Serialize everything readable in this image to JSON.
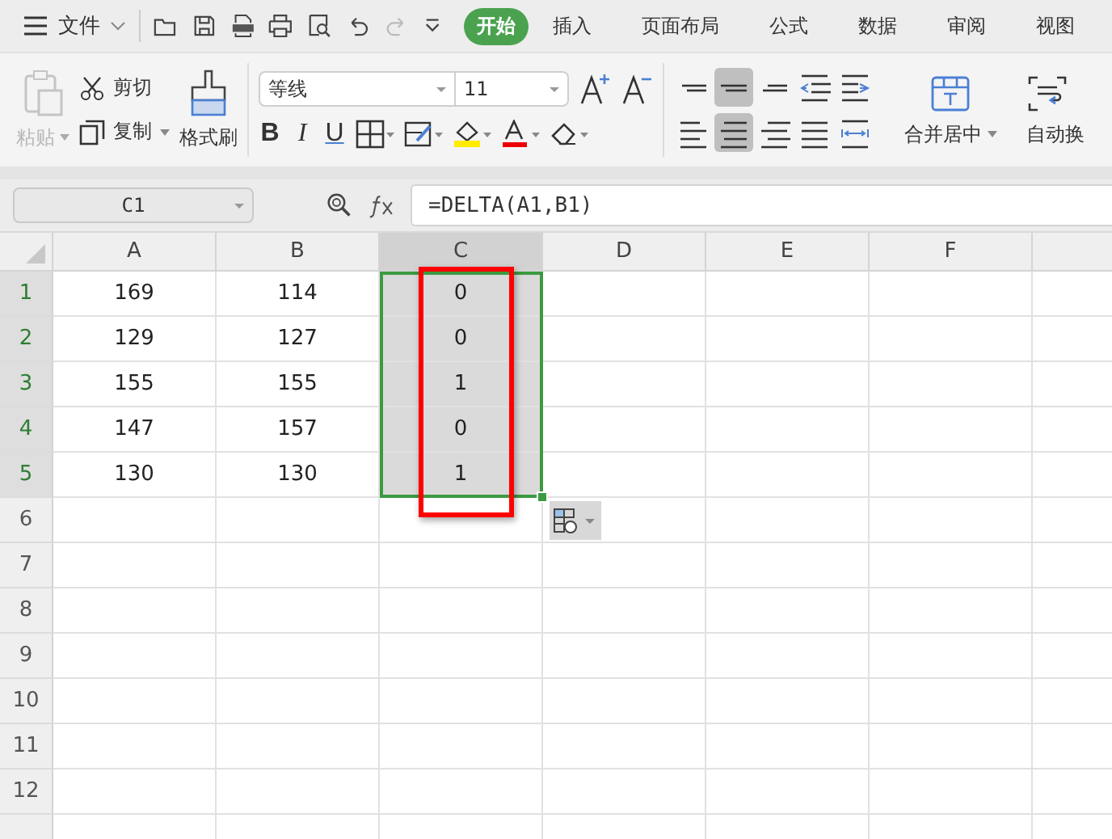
{
  "menu_bar": {
    "menu_label": "文件",
    "tabs": [
      {
        "label": "开始",
        "selected": true
      },
      {
        "label": "插入",
        "selected": false
      },
      {
        "label": "页面布局",
        "selected": false
      },
      {
        "label": "公式",
        "selected": false
      },
      {
        "label": "数据",
        "selected": false
      },
      {
        "label": "审阅",
        "selected": false
      },
      {
        "label": "视图",
        "selected": false
      }
    ]
  },
  "ribbon": {
    "clipboard": [
      {
        "kind": "paste",
        "label": "粘贴",
        "disabled": true
      },
      {
        "kind": "cut",
        "label": "剪切",
        "disabled": false
      },
      {
        "kind": "copy",
        "label": "复制",
        "disabled": false
      },
      {
        "kind": "format_painter",
        "label": "格式刷",
        "disabled": false
      }
    ],
    "font_name": "等线",
    "font_size": "11",
    "font_buttons": [
      {
        "label": "B"
      },
      {
        "label": "I"
      },
      {
        "label": "U"
      }
    ],
    "align_buttons": [
      {
        "kind": "top",
        "selected": false
      },
      {
        "kind": "middle",
        "selected": true
      },
      {
        "kind": "bottom",
        "selected": false
      },
      {
        "kind": "outdent",
        "selected": false
      },
      {
        "kind": "indent",
        "selected": false
      },
      {
        "kind": "left",
        "selected": false
      },
      {
        "kind": "center",
        "selected": true
      },
      {
        "kind": "right",
        "selected": false
      },
      {
        "kind": "justify",
        "selected": false
      },
      {
        "kind": "distribute",
        "selected": false
      }
    ],
    "merge_label": "合并居中",
    "wrap_label": "自动换"
  },
  "formula_bar": {
    "name_box": "C1",
    "formula": "=DELTA(A1,B1)"
  },
  "sheet": {
    "columns": [
      {
        "label": "A",
        "selected": false
      },
      {
        "label": "B",
        "selected": false
      },
      {
        "label": "C",
        "selected": true
      },
      {
        "label": "D",
        "selected": false
      },
      {
        "label": "E",
        "selected": false
      },
      {
        "label": "F",
        "selected": false
      }
    ],
    "rows": [
      {
        "label": "1",
        "selected": true,
        "cells": [
          "169",
          "114",
          "0"
        ]
      },
      {
        "label": "2",
        "selected": true,
        "cells": [
          "129",
          "127",
          "0"
        ]
      },
      {
        "label": "3",
        "selected": true,
        "cells": [
          "155",
          "155",
          "1"
        ]
      },
      {
        "label": "4",
        "selected": true,
        "cells": [
          "147",
          "157",
          "0"
        ]
      },
      {
        "label": "5",
        "selected": true,
        "cells": [
          "130",
          "130",
          "1"
        ]
      },
      {
        "label": "6",
        "selected": false,
        "cells": []
      },
      {
        "label": "7",
        "selected": false,
        "cells": []
      },
      {
        "label": "8",
        "selected": false,
        "cells": []
      },
      {
        "label": "9",
        "selected": false,
        "cells": []
      },
      {
        "label": "10",
        "selected": false,
        "cells": []
      },
      {
        "label": "11",
        "selected": false,
        "cells": []
      },
      {
        "label": "12",
        "selected": false,
        "cells": []
      }
    ]
  }
}
